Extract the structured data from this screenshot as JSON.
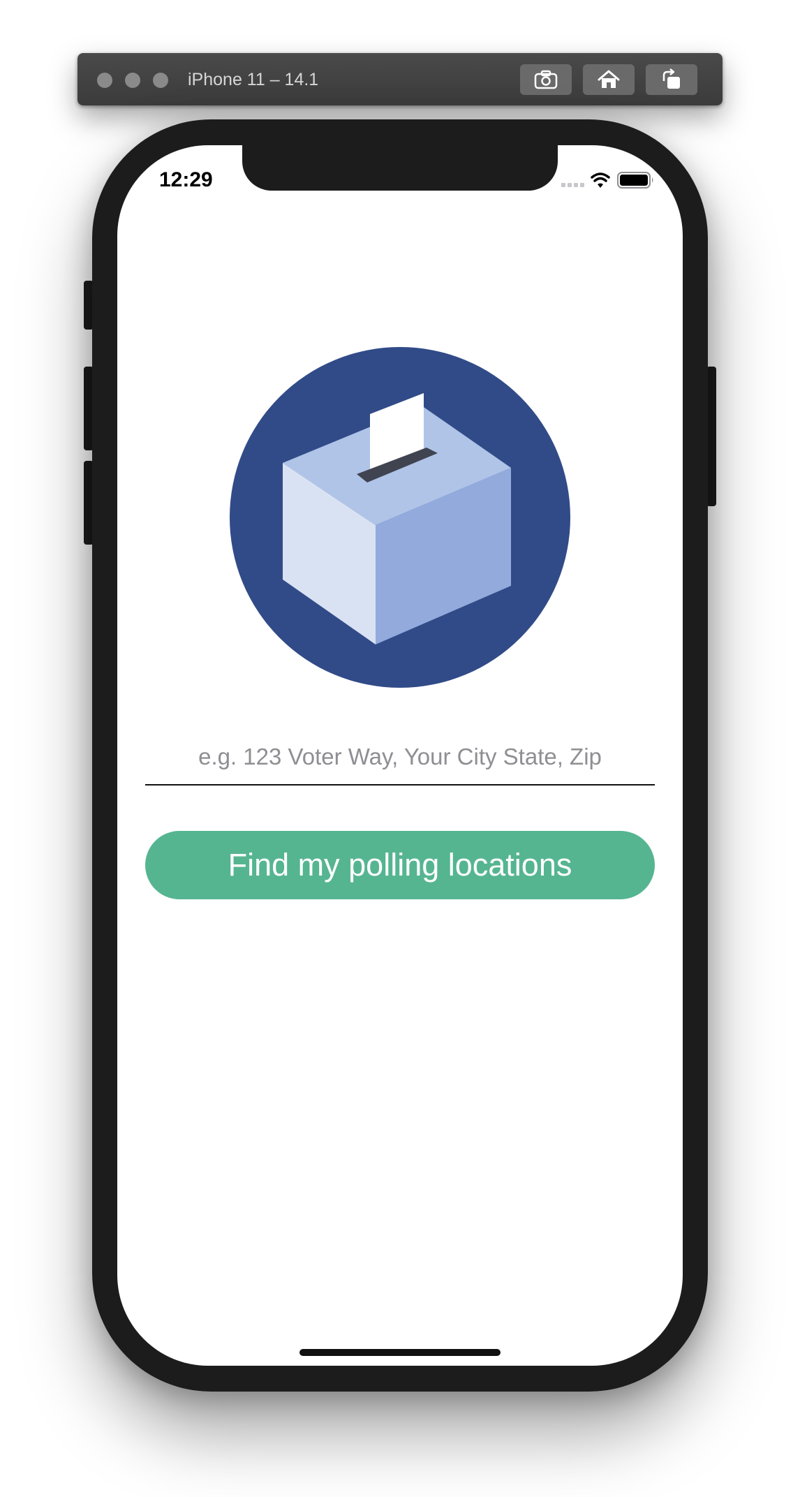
{
  "window": {
    "title": "iPhone 11 – 14.1",
    "toolbar": {
      "screenshot_icon": "camera-icon",
      "home_icon": "home-icon",
      "rotate_icon": "rotate-icon"
    }
  },
  "status_bar": {
    "time": "12:29",
    "icons": [
      "cellular-signal-icon",
      "wifi-icon",
      "battery-icon"
    ]
  },
  "main": {
    "illustration": "ballot-box-icon",
    "address_input": {
      "placeholder": "e.g. 123 Voter Way, Your City State, Zip",
      "value": ""
    },
    "find_button_label": "Find my polling locations"
  },
  "colors": {
    "circle": "#314b88",
    "box_top": "#b0c4e8",
    "box_left": "#d9e2f3",
    "box_right": "#92abdc",
    "button": "#56b591",
    "slot": "#3f4450"
  }
}
